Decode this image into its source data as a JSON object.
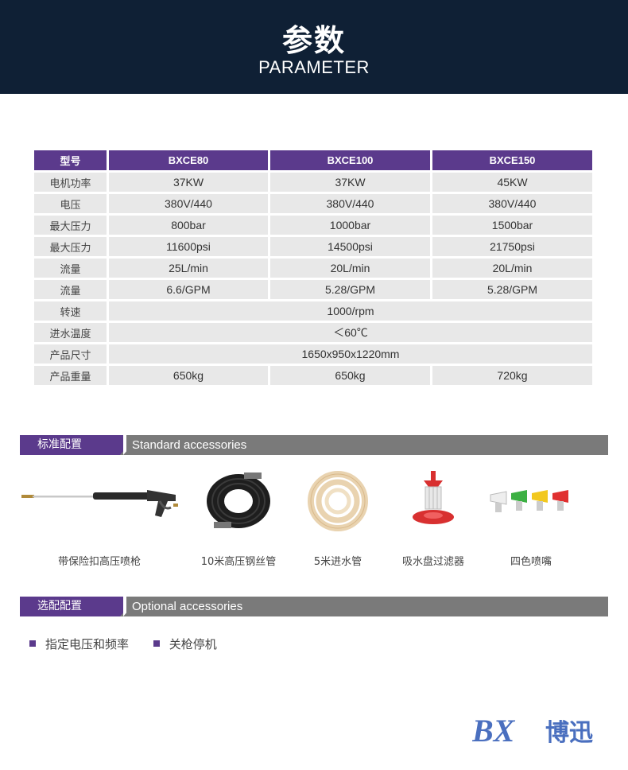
{
  "header": {
    "title": "参数",
    "subtitle": "PARAMETER"
  },
  "spec": {
    "columns": [
      "型号",
      "BXCE80",
      "BXCE100",
      "BXCE150"
    ],
    "rows": [
      [
        "电机功率",
        "37KW",
        "37KW",
        "45KW"
      ],
      [
        "电压",
        "380V/440",
        "380V/440",
        "380V/440"
      ],
      [
        "最大压力",
        "800bar",
        "1000bar",
        "1500bar"
      ],
      [
        "最大压力",
        "11600psi",
        "14500psi",
        "21750psi"
      ],
      [
        "流量",
        "25L/min",
        "20L/min",
        "20L/min"
      ],
      [
        "流量",
        "6.6/GPM",
        "5.28/GPM",
        "5.28/GPM"
      ],
      [
        "转速",
        "1000/rpm"
      ],
      [
        "进水温度",
        "＜60℃"
      ],
      [
        "产品尺寸",
        "1650x950x1220mm"
      ],
      [
        "产品重量",
        "650kg",
        "650kg",
        "720kg"
      ]
    ]
  },
  "standard": {
    "cn": "标准配置",
    "en": "Standard accessories",
    "items": [
      {
        "label": "带保险扣高压喷枪",
        "icon": "spray-gun-icon"
      },
      {
        "label": "10米高压钢丝管",
        "icon": "hose-coil-icon"
      },
      {
        "label": "5米进水管",
        "icon": "water-hose-icon"
      },
      {
        "label": "吸水盘过滤器",
        "icon": "filter-icon"
      },
      {
        "label": "四色喷嘴",
        "icon": "nozzle-icon"
      }
    ]
  },
  "optional": {
    "cn": "选配配置",
    "en": "Optional accessories",
    "items": [
      "指定电压和频率",
      "关枪停机"
    ]
  },
  "brand": {
    "text": "博迅",
    "mark": "BX"
  },
  "colors": {
    "header": "#0f2035",
    "accent": "#5b3a8c",
    "bar": "#7a7a7a",
    "cell": "#e8e8e8",
    "logo": "#4a6fbf"
  }
}
